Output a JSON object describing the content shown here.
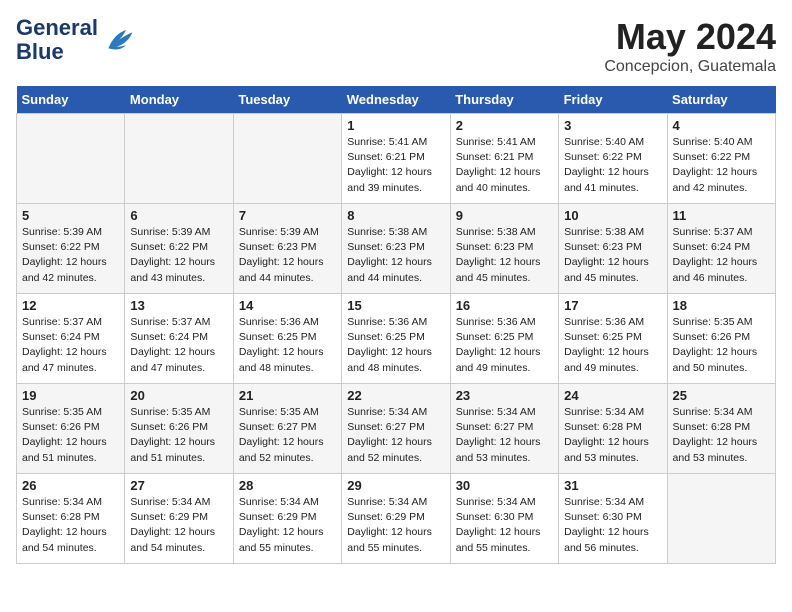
{
  "header": {
    "logo_line1": "General",
    "logo_line2": "Blue",
    "month_year": "May 2024",
    "location": "Concepcion, Guatemala"
  },
  "weekdays": [
    "Sunday",
    "Monday",
    "Tuesday",
    "Wednesday",
    "Thursday",
    "Friday",
    "Saturday"
  ],
  "weeks": [
    [
      {
        "day": "",
        "info": ""
      },
      {
        "day": "",
        "info": ""
      },
      {
        "day": "",
        "info": ""
      },
      {
        "day": "1",
        "info": "Sunrise: 5:41 AM\nSunset: 6:21 PM\nDaylight: 12 hours\nand 39 minutes."
      },
      {
        "day": "2",
        "info": "Sunrise: 5:41 AM\nSunset: 6:21 PM\nDaylight: 12 hours\nand 40 minutes."
      },
      {
        "day": "3",
        "info": "Sunrise: 5:40 AM\nSunset: 6:22 PM\nDaylight: 12 hours\nand 41 minutes."
      },
      {
        "day": "4",
        "info": "Sunrise: 5:40 AM\nSunset: 6:22 PM\nDaylight: 12 hours\nand 42 minutes."
      }
    ],
    [
      {
        "day": "5",
        "info": "Sunrise: 5:39 AM\nSunset: 6:22 PM\nDaylight: 12 hours\nand 42 minutes."
      },
      {
        "day": "6",
        "info": "Sunrise: 5:39 AM\nSunset: 6:22 PM\nDaylight: 12 hours\nand 43 minutes."
      },
      {
        "day": "7",
        "info": "Sunrise: 5:39 AM\nSunset: 6:23 PM\nDaylight: 12 hours\nand 44 minutes."
      },
      {
        "day": "8",
        "info": "Sunrise: 5:38 AM\nSunset: 6:23 PM\nDaylight: 12 hours\nand 44 minutes."
      },
      {
        "day": "9",
        "info": "Sunrise: 5:38 AM\nSunset: 6:23 PM\nDaylight: 12 hours\nand 45 minutes."
      },
      {
        "day": "10",
        "info": "Sunrise: 5:38 AM\nSunset: 6:23 PM\nDaylight: 12 hours\nand 45 minutes."
      },
      {
        "day": "11",
        "info": "Sunrise: 5:37 AM\nSunset: 6:24 PM\nDaylight: 12 hours\nand 46 minutes."
      }
    ],
    [
      {
        "day": "12",
        "info": "Sunrise: 5:37 AM\nSunset: 6:24 PM\nDaylight: 12 hours\nand 47 minutes."
      },
      {
        "day": "13",
        "info": "Sunrise: 5:37 AM\nSunset: 6:24 PM\nDaylight: 12 hours\nand 47 minutes."
      },
      {
        "day": "14",
        "info": "Sunrise: 5:36 AM\nSunset: 6:25 PM\nDaylight: 12 hours\nand 48 minutes."
      },
      {
        "day": "15",
        "info": "Sunrise: 5:36 AM\nSunset: 6:25 PM\nDaylight: 12 hours\nand 48 minutes."
      },
      {
        "day": "16",
        "info": "Sunrise: 5:36 AM\nSunset: 6:25 PM\nDaylight: 12 hours\nand 49 minutes."
      },
      {
        "day": "17",
        "info": "Sunrise: 5:36 AM\nSunset: 6:25 PM\nDaylight: 12 hours\nand 49 minutes."
      },
      {
        "day": "18",
        "info": "Sunrise: 5:35 AM\nSunset: 6:26 PM\nDaylight: 12 hours\nand 50 minutes."
      }
    ],
    [
      {
        "day": "19",
        "info": "Sunrise: 5:35 AM\nSunset: 6:26 PM\nDaylight: 12 hours\nand 51 minutes."
      },
      {
        "day": "20",
        "info": "Sunrise: 5:35 AM\nSunset: 6:26 PM\nDaylight: 12 hours\nand 51 minutes."
      },
      {
        "day": "21",
        "info": "Sunrise: 5:35 AM\nSunset: 6:27 PM\nDaylight: 12 hours\nand 52 minutes."
      },
      {
        "day": "22",
        "info": "Sunrise: 5:34 AM\nSunset: 6:27 PM\nDaylight: 12 hours\nand 52 minutes."
      },
      {
        "day": "23",
        "info": "Sunrise: 5:34 AM\nSunset: 6:27 PM\nDaylight: 12 hours\nand 53 minutes."
      },
      {
        "day": "24",
        "info": "Sunrise: 5:34 AM\nSunset: 6:28 PM\nDaylight: 12 hours\nand 53 minutes."
      },
      {
        "day": "25",
        "info": "Sunrise: 5:34 AM\nSunset: 6:28 PM\nDaylight: 12 hours\nand 53 minutes."
      }
    ],
    [
      {
        "day": "26",
        "info": "Sunrise: 5:34 AM\nSunset: 6:28 PM\nDaylight: 12 hours\nand 54 minutes."
      },
      {
        "day": "27",
        "info": "Sunrise: 5:34 AM\nSunset: 6:29 PM\nDaylight: 12 hours\nand 54 minutes."
      },
      {
        "day": "28",
        "info": "Sunrise: 5:34 AM\nSunset: 6:29 PM\nDaylight: 12 hours\nand 55 minutes."
      },
      {
        "day": "29",
        "info": "Sunrise: 5:34 AM\nSunset: 6:29 PM\nDaylight: 12 hours\nand 55 minutes."
      },
      {
        "day": "30",
        "info": "Sunrise: 5:34 AM\nSunset: 6:30 PM\nDaylight: 12 hours\nand 55 minutes."
      },
      {
        "day": "31",
        "info": "Sunrise: 5:34 AM\nSunset: 6:30 PM\nDaylight: 12 hours\nand 56 minutes."
      },
      {
        "day": "",
        "info": ""
      }
    ]
  ]
}
